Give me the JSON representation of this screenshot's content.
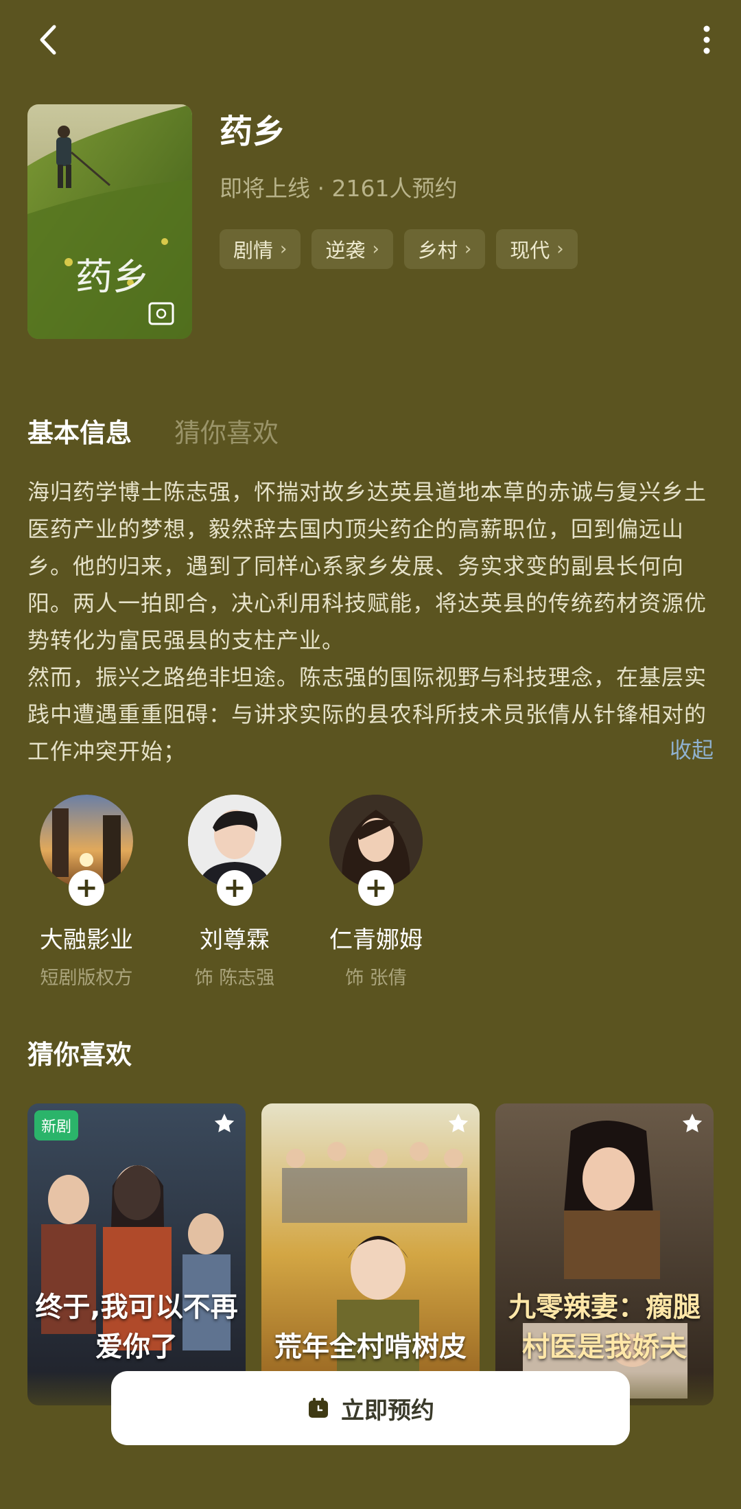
{
  "header": {
    "back_icon": "chevron-left-icon",
    "more_icon": "vertical-dots-icon"
  },
  "drama": {
    "title": "药乡",
    "meta": "即将上线 · 2161人预约",
    "tags": [
      "剧情",
      "逆袭",
      "乡村",
      "现代"
    ],
    "poster_text": "药乡"
  },
  "tabs": {
    "basic": "基本信息",
    "recommend": "猜你喜欢"
  },
  "description": {
    "p1": "海归药学博士陈志强，怀揣对故乡达英县道地本草的赤诚与复兴乡土医药产业的梦想，毅然辞去国内顶尖药企的高薪职位，回到偏远山乡。他的归来，遇到了同样心系家乡发展、务实求变的副县长何向阳。两人一拍即合，决心利用科技赋能，将达英县的传统药材资源优势转化为富民强县的支柱产业。",
    "p2": "然而，振兴之路绝非坦途。陈志强的国际视野与科技理念，在基层实践中遭遇重重阻碍：与讲求实际的县农科所技术员张倩从针锋相对的工作冲突开始；",
    "collapse": "收起"
  },
  "cast": [
    {
      "name": "大融影业",
      "role": "短剧版权方"
    },
    {
      "name": "刘尊霖",
      "role": "饰 陈志强"
    },
    {
      "name": "仁青娜姆",
      "role": "饰 张倩"
    }
  ],
  "recommend": {
    "title": "猜你喜欢",
    "cards": [
      {
        "title": "终于,我可以不再爱你了",
        "badge": "新剧"
      },
      {
        "title": "荒年全村啃树皮",
        "badge": ""
      },
      {
        "title": "九零辣妻：瘸腿村医是我娇夫",
        "badge": ""
      }
    ]
  },
  "cta": {
    "label": "立即预约",
    "icon": "calendar-icon"
  },
  "colors": {
    "background": "#5b5420",
    "link": "#8fb1cf",
    "new_badge": "#2bb46a"
  }
}
